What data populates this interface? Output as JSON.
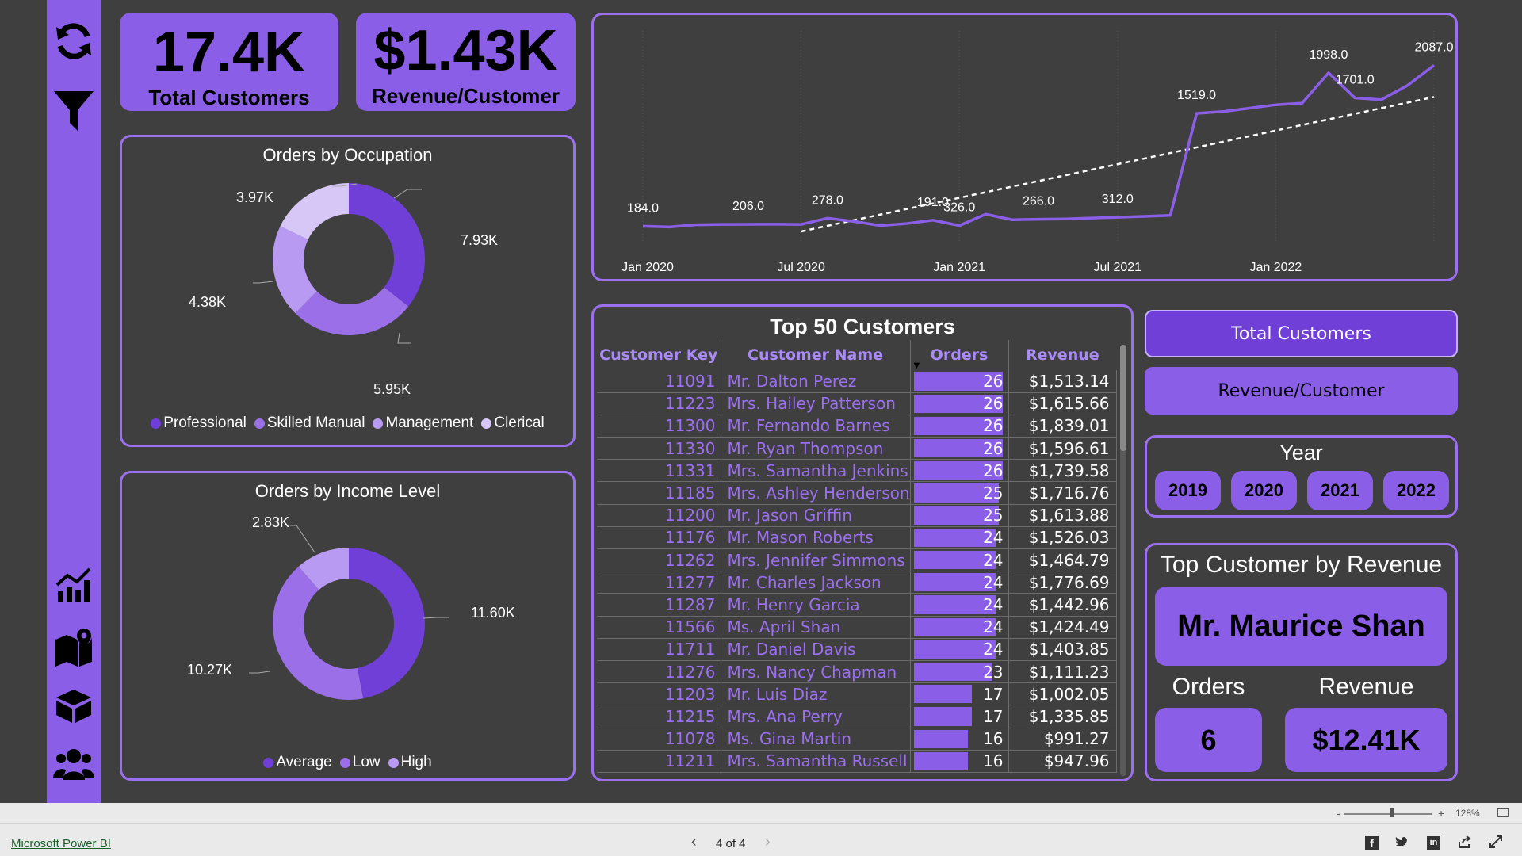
{
  "sidebar": {
    "icons": [
      "refresh-icon",
      "filter-icon",
      "chart-icon",
      "map-icon",
      "box-icon",
      "users-icon"
    ]
  },
  "kpis": {
    "total_customers": {
      "value": "17.4K",
      "label": "Total Customers"
    },
    "revenue_per_customer": {
      "value": "$1.43K",
      "label": "Revenue/Customer"
    }
  },
  "occupation": {
    "title": "Orders by Occupation",
    "labels": [
      "7.93K",
      "5.95K",
      "4.38K",
      "3.97K"
    ],
    "legend": [
      "Professional",
      "Skilled Manual",
      "Management",
      "Clerical"
    ]
  },
  "income": {
    "title": "Orders by Income Level",
    "labels": [
      "11.60K",
      "10.27K",
      "2.83K"
    ],
    "legend": [
      "Average",
      "Low",
      "High"
    ]
  },
  "chart_data": [
    {
      "type": "pie",
      "title": "Orders by Occupation",
      "categories": [
        "Professional",
        "Skilled Manual",
        "Management",
        "Clerical"
      ],
      "values": [
        7930,
        5950,
        4380,
        3970
      ],
      "value_labels": [
        "7.93K",
        "5.95K",
        "4.38K",
        "3.97K"
      ],
      "colors": [
        "#6f3fd8",
        "#9b6fe8",
        "#b99af2",
        "#d7c7f7"
      ],
      "legend": "bottom"
    },
    {
      "type": "pie",
      "title": "Orders by Income Level",
      "categories": [
        "Average",
        "Low",
        "High"
      ],
      "values": [
        11600,
        10270,
        2830
      ],
      "value_labels": [
        "11.60K",
        "10.27K",
        "2.83K"
      ],
      "colors": [
        "#6f3fd8",
        "#9b6fe8",
        "#b99af2"
      ],
      "legend": "bottom"
    },
    {
      "type": "line",
      "x": [
        "2020-01",
        "2020-02",
        "2020-03",
        "2020-04",
        "2020-05",
        "2020-06",
        "2020-07",
        "2020-08",
        "2020-09",
        "2020-10",
        "2020-11",
        "2020-12",
        "2021-01",
        "2021-02",
        "2021-03",
        "2021-04",
        "2021-05",
        "2021-06",
        "2021-07",
        "2021-08",
        "2021-09",
        "2021-10",
        "2021-11",
        "2021-12",
        "2022-01",
        "2022-02",
        "2022-03",
        "2022-04",
        "2022-05",
        "2022-06",
        "2022-07"
      ],
      "values": [
        184,
        175,
        200,
        205,
        206,
        208,
        205,
        278,
        240,
        191,
        215,
        255,
        191,
        326,
        260,
        266,
        270,
        280,
        290,
        300,
        312,
        1519,
        1540,
        1580,
        1620,
        1640,
        1998,
        1701,
        1680,
        1850,
        2087
      ],
      "point_labels": [
        {
          "x": "2020-01",
          "label": "184.0"
        },
        {
          "x": "2020-05",
          "label": "206.0"
        },
        {
          "x": "2020-08",
          "label": "278.0"
        },
        {
          "x": "2020-12",
          "label": "191.0"
        },
        {
          "x": "2021-01",
          "label": "326.0"
        },
        {
          "x": "2021-04",
          "label": "266.0"
        },
        {
          "x": "2021-07",
          "label": "312.0"
        },
        {
          "x": "2021-10",
          "label": "1519.0"
        },
        {
          "x": "2022-03",
          "label": "1998.0"
        },
        {
          "x": "2022-04",
          "label": "1701.0"
        },
        {
          "x": "2022-07",
          "label": "2087.0"
        }
      ],
      "x_ticks": [
        "Jan 2020",
        "Jul 2020",
        "Jan 2021",
        "Jul 2021",
        "Jan 2022"
      ],
      "trendline": true,
      "ylim": [
        0,
        2400
      ]
    }
  ],
  "line_chart": {
    "x_ticks": [
      "Jan 2020",
      "Jul 2020",
      "Jan 2021",
      "Jul 2021",
      "Jan 2022"
    ]
  },
  "table": {
    "title": "Top 50 Customers",
    "headers": [
      "Customer Key",
      "Customer Name",
      "Orders",
      "Revenue"
    ],
    "rows": [
      {
        "key": "11091",
        "name": "Mr. Dalton Perez",
        "orders": 26,
        "revenue": "$1,513.14"
      },
      {
        "key": "11223",
        "name": "Mrs. Hailey Patterson",
        "orders": 26,
        "revenue": "$1,615.66"
      },
      {
        "key": "11300",
        "name": "Mr. Fernando Barnes",
        "orders": 26,
        "revenue": "$1,839.01"
      },
      {
        "key": "11330",
        "name": "Mr. Ryan Thompson",
        "orders": 26,
        "revenue": "$1,596.61"
      },
      {
        "key": "11331",
        "name": "Mrs. Samantha Jenkins",
        "orders": 26,
        "revenue": "$1,739.58"
      },
      {
        "key": "11185",
        "name": "Mrs. Ashley Henderson",
        "orders": 25,
        "revenue": "$1,716.76"
      },
      {
        "key": "11200",
        "name": "Mr. Jason Griffin",
        "orders": 25,
        "revenue": "$1,613.88"
      },
      {
        "key": "11176",
        "name": "Mr. Mason Roberts",
        "orders": 24,
        "revenue": "$1,526.03"
      },
      {
        "key": "11262",
        "name": "Mrs. Jennifer Simmons",
        "orders": 24,
        "revenue": "$1,464.79"
      },
      {
        "key": "11277",
        "name": "Mr. Charles Jackson",
        "orders": 24,
        "revenue": "$1,776.69"
      },
      {
        "key": "11287",
        "name": "Mr. Henry Garcia",
        "orders": 24,
        "revenue": "$1,442.96"
      },
      {
        "key": "11566",
        "name": "Ms. April Shan",
        "orders": 24,
        "revenue": "$1,424.49"
      },
      {
        "key": "11711",
        "name": "Mr. Daniel Davis",
        "orders": 24,
        "revenue": "$1,403.85"
      },
      {
        "key": "11276",
        "name": "Mrs. Nancy Chapman",
        "orders": 23,
        "revenue": "$1,111.23"
      },
      {
        "key": "11203",
        "name": "Mr. Luis Diaz",
        "orders": 17,
        "revenue": "$1,002.05"
      },
      {
        "key": "11215",
        "name": "Mrs. Ana Perry",
        "orders": 17,
        "revenue": "$1,335.85"
      },
      {
        "key": "11078",
        "name": "Ms. Gina Martin",
        "orders": 16,
        "revenue": "$991.27"
      },
      {
        "key": "11211",
        "name": "Mrs. Samantha Russell",
        "orders": 16,
        "revenue": "$947.96"
      }
    ]
  },
  "buttons": {
    "total_customers": "Total Customers",
    "revenue_customer": "Revenue/Customer"
  },
  "year_filter": {
    "title": "Year",
    "options": [
      "2019",
      "2020",
      "2021",
      "2022"
    ]
  },
  "top_customer": {
    "title": "Top Customer by Revenue",
    "name": "Mr. Maurice Shan",
    "orders_label": "Orders",
    "revenue_label": "Revenue",
    "orders_value": "6",
    "revenue_value": "$12.41K"
  },
  "footer": {
    "brand": "Microsoft Power BI",
    "page": "4 of 4",
    "zoom": "128%",
    "zoom_minus": "-",
    "zoom_plus": "+",
    "prev": "‹",
    "next": "›"
  },
  "colors": {
    "accent": "#8b5ee8",
    "accent_dark": "#6f3fd8",
    "background": "#3f3f3f",
    "border": "#9b6ff0"
  }
}
